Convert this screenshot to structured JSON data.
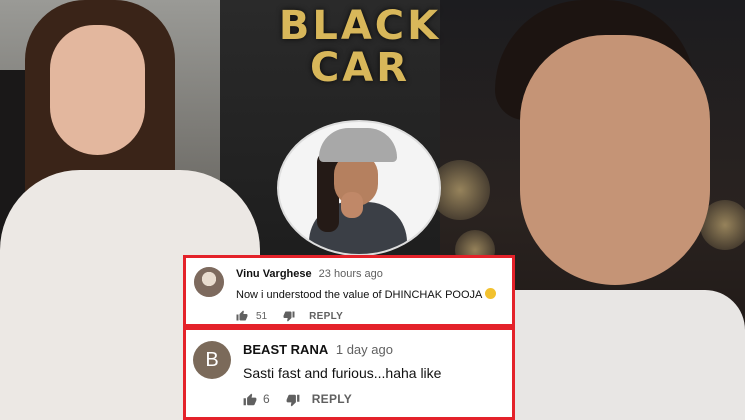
{
  "title": {
    "line1": "BLACK",
    "line2": "CAR"
  },
  "comments": [
    {
      "author": "Vinu Varghese",
      "time": "23 hours ago",
      "text": "Now i understood the value of DHINCHAK POOJA",
      "emoji": "slightly-sad-face",
      "likes": "51",
      "reply_label": "REPLY",
      "avatar_letter": ""
    },
    {
      "author": "BEAST RANA",
      "time": "1 day ago",
      "text": "Sasti fast and furious...haha like",
      "likes": "6",
      "reply_label": "REPLY",
      "avatar_letter": "B"
    }
  ],
  "colors": {
    "title_gold": "#d8b75a",
    "comment_border": "#e4222a",
    "avatar_b_bg": "#7b6a5a"
  },
  "icons": [
    "thumbs-up-icon",
    "thumbs-down-icon"
  ]
}
